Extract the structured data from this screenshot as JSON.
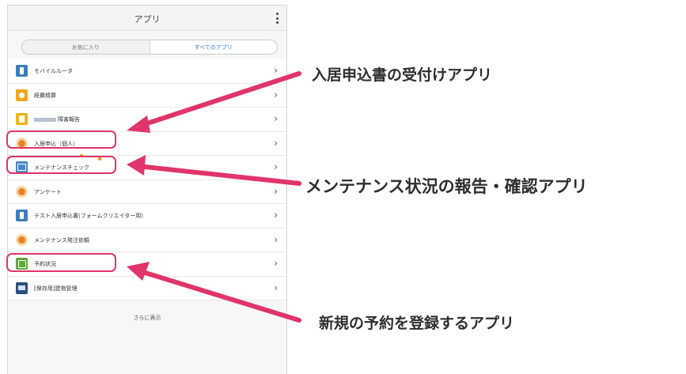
{
  "header": {
    "title": "アプリ",
    "menu_icon": "kebab-menu-icon"
  },
  "tabs": {
    "favorites": "お気に入り",
    "all_apps": "すべてのアプリ",
    "selected": "all_apps"
  },
  "apps": [
    {
      "label": "モバイルルータ",
      "icon": "router-app-icon"
    },
    {
      "label": "経費精算",
      "icon": "expense-app-icon"
    },
    {
      "label": "障害報告",
      "icon": "trouble-report-app-icon",
      "label_prefix_obscured": true
    },
    {
      "label": "入居申込（個人）",
      "icon": "person-app-icon",
      "highlighted": true
    },
    {
      "label": "メンテナンスチェック",
      "icon": "checklist-app-icon",
      "highlighted": true,
      "has_notification": true
    },
    {
      "label": "アンケート",
      "icon": "person-app-icon"
    },
    {
      "label": "テスト入居申込書(フォームクリエイター用)",
      "icon": "form-app-icon"
    },
    {
      "label": "メンテナンス発注依頼",
      "icon": "person-app-icon"
    },
    {
      "label": "予約状況",
      "icon": "reservation-app-icon",
      "highlighted": true
    },
    {
      "label": "[保存用]建物管理",
      "icon": "building-app-icon"
    }
  ],
  "chevron": "›",
  "show_more": "さらに表示",
  "annotations": {
    "move_in_app": "入居申込書の受付けアプリ",
    "maintenance_app": "メンテナンス状況の報告・確認アプリ",
    "reservation_app": "新規の予約を登録するアプリ"
  },
  "colors": {
    "highlight": "#e0356b",
    "tab_active": "#2f7fd6",
    "notification": "#f08a16"
  }
}
